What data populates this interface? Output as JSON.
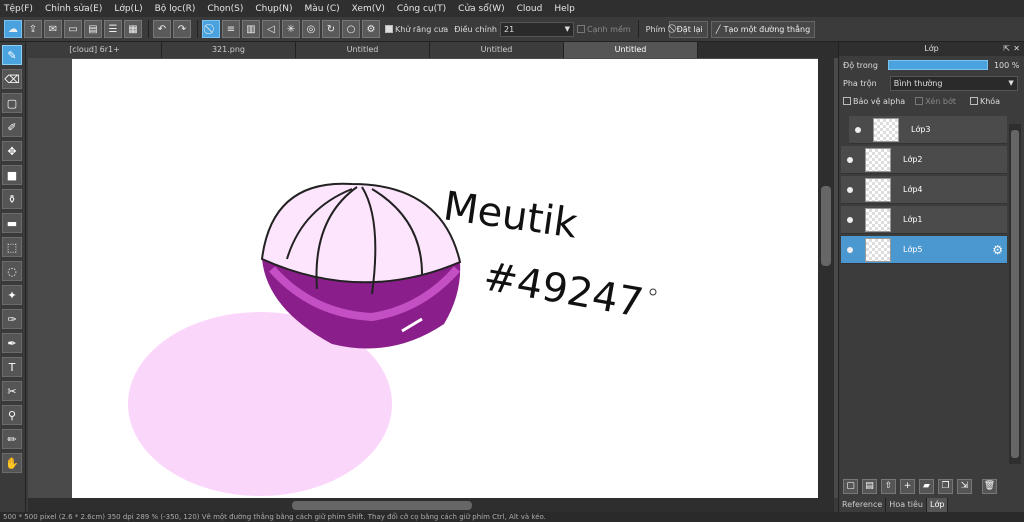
{
  "menu": [
    "Tệp(F)",
    "Chỉnh sửa(E)",
    "Lớp(L)",
    "Bộ lọc(R)",
    "Chọn(S)",
    "Chụp(N)",
    "Màu (C)",
    "Xem(V)",
    "Công cụ(T)",
    "Cửa sổ(W)",
    "Cloud",
    "Help"
  ],
  "toolbar": {
    "antialias": "Khử răng cưa",
    "adjust": "Điều chỉnh",
    "adjust_value": "21",
    "smooth_edge": "Cạnh mềm",
    "key_label": "Phím",
    "reset": "Đặt lại",
    "straight_line": "Tạo một đường thẳng"
  },
  "tabs": [
    "[cloud] 6r1+",
    "321.png",
    "Untitled",
    "Untitled",
    "Untitled"
  ],
  "panel": {
    "title": "Lớp",
    "opacity_label": "Độ trong",
    "opacity_value": "100 %",
    "opacity": 1.0,
    "blend_label": "Pha trộn",
    "blend_value": "Bình thường",
    "protect_alpha": "Bảo vệ alpha",
    "clipping": "Xén bớt",
    "lock": "Khóa",
    "layers": [
      "Lớp3",
      "Lớp2",
      "Lớp4",
      "Lớp1",
      "Lớp5"
    ],
    "bottom_tabs": [
      "Reference",
      "Hoa tiêu",
      "Lớp"
    ]
  },
  "canvas_text": {
    "line1": "Meutik",
    "line2": "#49247"
  },
  "status": "500 * 500 pixel   (2.6 * 2.6cm)   350 dpi   289 %   (-350, 120)   Vẽ một đường thẳng bằng cách giữ phím Shift. Thay đổi cỡ cọ bằng cách giữ phím Ctrl, Alt và kéo."
}
